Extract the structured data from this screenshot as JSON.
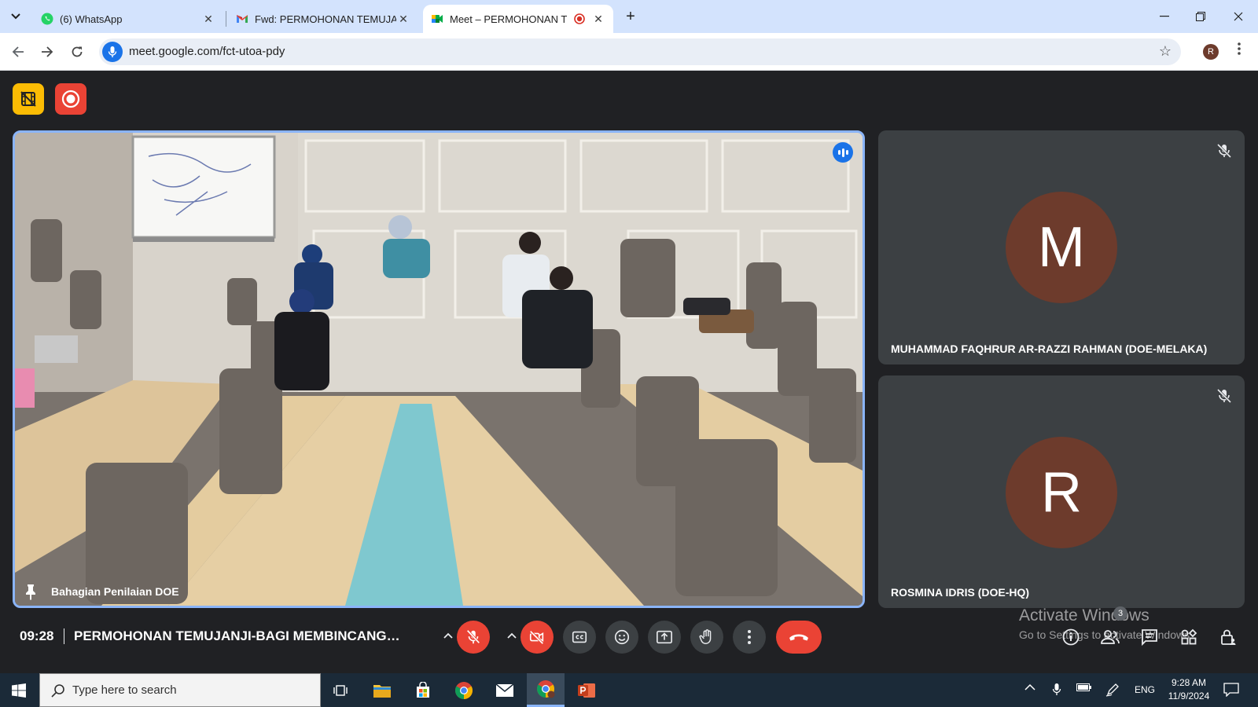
{
  "browser": {
    "tabs": [
      {
        "label": "(6) WhatsApp",
        "icon": "whatsapp-icon",
        "active": false
      },
      {
        "label": "Fwd: PERMOHONAN TEMUJAN",
        "icon": "gmail-icon",
        "active": false
      },
      {
        "label": "Meet – PERMOHONAN TEM",
        "icon": "meet-icon",
        "active": true
      }
    ],
    "url": "meet.google.com/fct-utoa-pdy",
    "profile_initial": "R"
  },
  "meet": {
    "main_participant": "Bahagian Penilaian DOE",
    "participants": [
      {
        "name": "MUHAMMAD FAQHRUR AR-RAZZI RAHMAN (DOE-MELAKA)",
        "initial": "M",
        "muted": true
      },
      {
        "name": "ROSMINA IDRIS (DOE-HQ)",
        "initial": "R",
        "muted": true
      }
    ],
    "time": "09:28",
    "title": "PERMOHONAN TEMUJANJI-BAGI MEMBINCANGK...",
    "people_count": "3",
    "colors": {
      "accent": "#8ab4f8",
      "end_call": "#ea4335",
      "avatar": "#6d3b2c"
    }
  },
  "watermark": {
    "line1": "Activate Windows",
    "line2": "Go to Settings to activate Windows."
  },
  "taskbar": {
    "search_placeholder": "Type here to search",
    "lang": "ENG",
    "time": "9:28 AM",
    "date": "11/9/2024"
  }
}
